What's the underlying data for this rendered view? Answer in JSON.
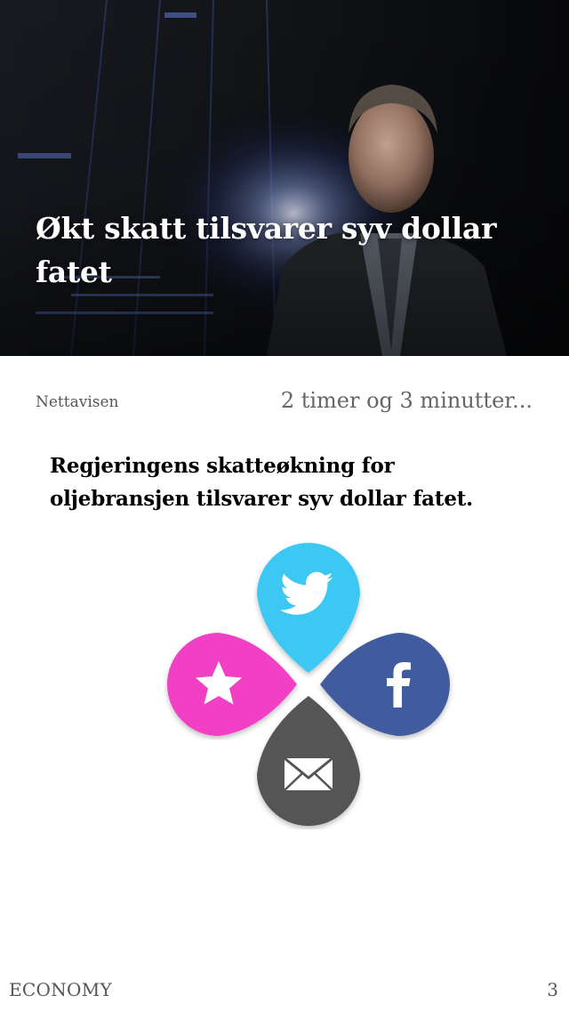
{
  "article": {
    "title": "Økt skatt tilsvarer syv dollar fatet",
    "source": "Nettavisen",
    "time_ago": "2 timer og 3 minutter...",
    "lead": "Regjeringens skatteøkning for oljebransjen tilsvarer syv dollar fatet."
  },
  "share": {
    "actions": [
      {
        "name": "twitter",
        "icon": "twitter-bird-icon",
        "color": "#3cc8f4"
      },
      {
        "name": "favorite",
        "icon": "star-icon",
        "color": "#f23fc4"
      },
      {
        "name": "facebook",
        "icon": "facebook-f-icon",
        "color": "#3f5c9e"
      },
      {
        "name": "email",
        "icon": "envelope-icon",
        "color": "#545454"
      }
    ]
  },
  "footer": {
    "category": "ECONOMY",
    "page_number": "3"
  }
}
